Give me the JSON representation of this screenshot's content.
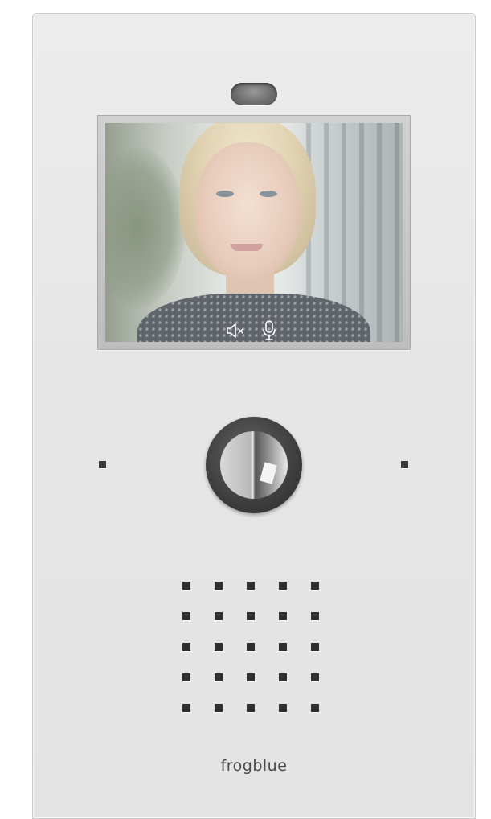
{
  "device": {
    "brand": "frogblue"
  },
  "screen": {
    "controls": [
      {
        "name": "mute-speaker",
        "icon": "speaker-muted-icon"
      },
      {
        "name": "microphone",
        "icon": "microphone-icon"
      }
    ]
  },
  "grille": {
    "rows": 5,
    "columns": 5
  },
  "colors": {
    "panel": "#e6e6e6",
    "dark_accent": "#2f2f2f"
  }
}
